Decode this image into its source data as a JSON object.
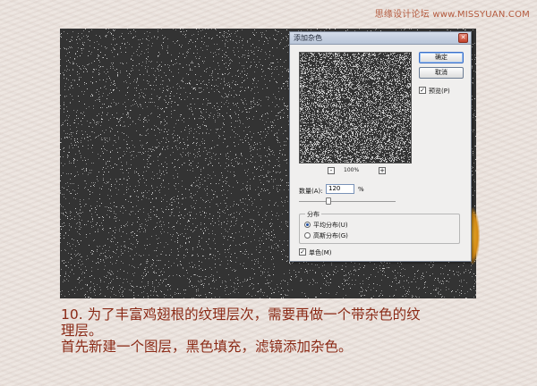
{
  "watermark": "思缘设计论坛 www.MISSYUAN.COM",
  "dialog": {
    "title": "添加杂色",
    "ok_label": "确定",
    "cancel_label": "取消",
    "preview_label": "预览(P)",
    "preview_checked": true,
    "zoom": {
      "minus": "-",
      "plus": "+",
      "value": "100%"
    },
    "amount_label": "数量(A):",
    "amount_value": "120",
    "amount_unit": "%",
    "distribution": {
      "title": "分布",
      "options": [
        "平均分布(U)",
        "高斯分布(G)"
      ],
      "selected_index": 0
    },
    "monochrome_label": "单色(M)",
    "monochrome_checked": true
  },
  "caption": {
    "line1": "10. 为了丰富鸡翅根的纹理层次，需要再做一个带杂色的纹",
    "line2": "理层。",
    "line3": "首先新建一个图层，黑色填充，滤镜添加杂色。"
  },
  "colors": {
    "caption": "#8b2a16",
    "watermark": "#b45a3e",
    "page_bg": "#ece4df",
    "noise_bg": "#3b3b3b"
  }
}
